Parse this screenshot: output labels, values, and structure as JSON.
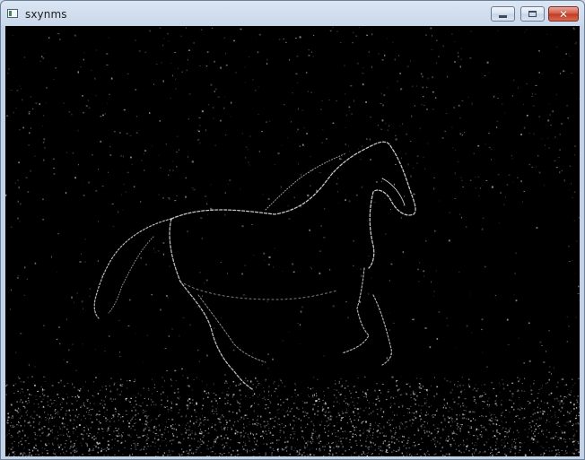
{
  "window": {
    "title": "sxynms",
    "icon": "app-window-icon",
    "controls": {
      "minimize_icon": "minimize-icon",
      "maximize_icon": "maximize-icon",
      "close_glyph": "✕"
    }
  },
  "image": {
    "subject": "",
    "background_color": "#000000",
    "edge_color": "#ffffff"
  }
}
